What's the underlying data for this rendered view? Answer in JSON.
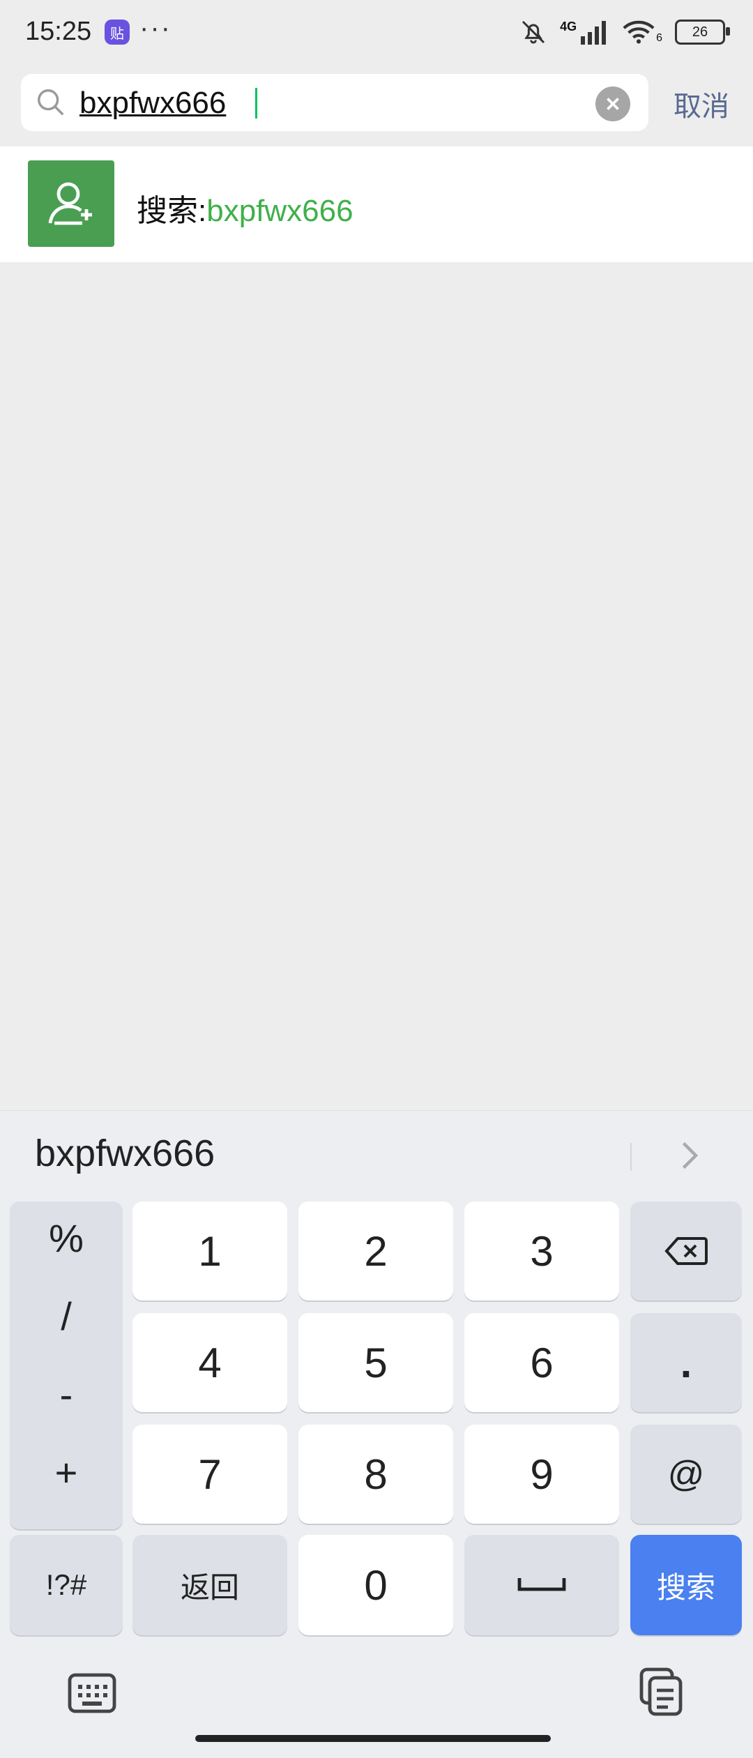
{
  "status_bar": {
    "time": "15:25",
    "app_icon_text": "贴",
    "more": "···",
    "network": "4G",
    "wifi_badge": "6",
    "battery": "26"
  },
  "search": {
    "value": "bxpfwx666",
    "clear_icon": "clear-circle-icon",
    "cancel_label": "取消"
  },
  "result": {
    "label": "搜索:",
    "query": "bxpfwx666",
    "icon": "add-user-icon"
  },
  "keyboard": {
    "suggestion": "bxpfwx666",
    "symbols": [
      "%",
      "/",
      "-",
      "+"
    ],
    "digits": [
      "1",
      "2",
      "3",
      "4",
      "5",
      "6",
      "7",
      "8",
      "9",
      "0"
    ],
    "dot": ".",
    "at": "@",
    "sym_toggle": "!?#",
    "back_label": "返回",
    "search_label": "搜索"
  },
  "colors": {
    "accent_green": "#3fb04a",
    "cancel_blue": "#586991",
    "search_key_blue": "#4a80f0"
  }
}
